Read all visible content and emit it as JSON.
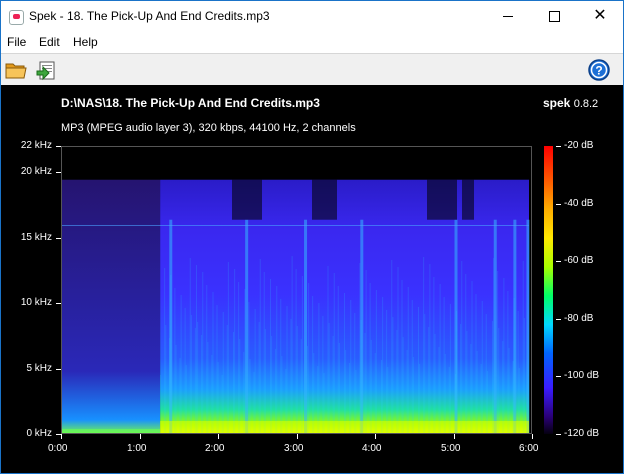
{
  "window": {
    "title": "Spek - 18. The Pick-Up And End Credits.mp3",
    "minimize_symbol": "",
    "close_symbol": "✕"
  },
  "menu": {
    "items": [
      "File",
      "Edit",
      "Help"
    ]
  },
  "toolbar": {
    "icons": [
      "folder-open-icon",
      "save-icon",
      "help-icon"
    ]
  },
  "spek": {
    "file_path": "D:\\NAS\\18. The Pick-Up And End Credits.mp3",
    "app_name": "spek",
    "version": "0.8.2",
    "file_info": "MP3 (MPEG audio layer 3), 320 kbps, 44100 Hz, 2 channels"
  },
  "chart_data": {
    "type": "heatmap",
    "title": "",
    "x_ticks": [
      "0:00",
      "1:00",
      "2:00",
      "3:00",
      "4:00",
      "5:00",
      "6:00"
    ],
    "y_ticks": [
      "22 kHz",
      "20 kHz",
      "15 kHz",
      "10 kHz",
      "5 kHz",
      "0 kHz"
    ],
    "x_range_seconds": [
      0,
      360
    ],
    "y_range_khz": [
      0,
      22
    ],
    "colorbar_ticks": [
      "-20 dB",
      "-40 dB",
      "-60 dB",
      "-80 dB",
      "-100 dB",
      "-120 dB"
    ],
    "colorbar_range_db": [
      -120,
      -20
    ],
    "frequency_cutoff_khz": 19.5,
    "colors": {
      "background": "#000000",
      "low": "#200060",
      "mid": "#1a4cff",
      "high": "#ffff00"
    }
  }
}
